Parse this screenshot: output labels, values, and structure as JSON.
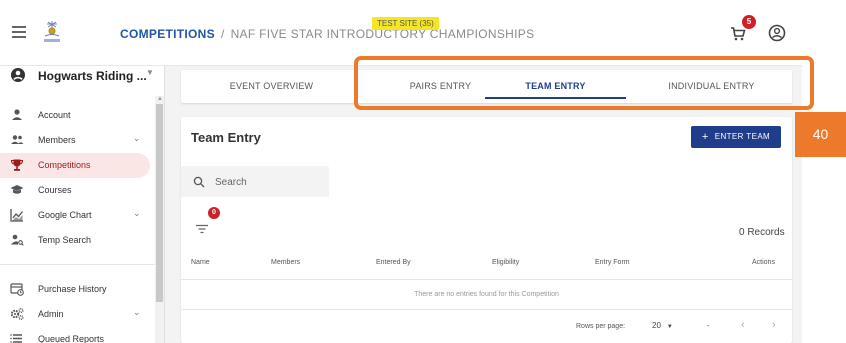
{
  "header": {
    "breadcrumb_link": "COMPETITIONS",
    "breadcrumb_sep": "/",
    "breadcrumb_current": "NAF FIVE STAR INTRODUCTORY CHAMPIONSHIPS",
    "test_badge": "TEST SITE (35)",
    "cart_count": "5"
  },
  "sidebar": {
    "org_name": "Hogwarts Riding ...",
    "items": [
      {
        "label": "Account",
        "icon": "person-icon"
      },
      {
        "label": "Members",
        "icon": "people-icon",
        "expandable": true
      },
      {
        "label": "Competitions",
        "icon": "trophy-icon",
        "active": true
      },
      {
        "label": "Courses",
        "icon": "graduation-cap-icon"
      },
      {
        "label": "Google Chart",
        "icon": "chart-icon",
        "expandable": true
      },
      {
        "label": "Temp Search",
        "icon": "person-search-icon"
      },
      {
        "label": "Purchase History",
        "icon": "purchase-history-icon"
      },
      {
        "label": "Admin",
        "icon": "gears-icon",
        "expandable": true
      },
      {
        "label": "Queued Reports",
        "icon": "list-icon"
      }
    ]
  },
  "tabs": [
    {
      "label": "EVENT OVERVIEW"
    },
    {
      "label": "PAIRS ENTRY"
    },
    {
      "label": "TEAM ENTRY",
      "active": true
    },
    {
      "label": "INDIVIDUAL ENTRY"
    }
  ],
  "team_entry": {
    "title": "Team Entry",
    "enter_button": "ENTER TEAM",
    "search_placeholder": "Search",
    "filter_count": "0",
    "records": "0 Records",
    "columns": [
      "Name",
      "Members",
      "Entered By",
      "Eligibility",
      "Entry Form",
      "Actions"
    ],
    "empty_message": "There are no entries found for this Competition",
    "rows_per_page_label": "Rows per page:",
    "rows_per_page_value": "20",
    "range": "-"
  },
  "annotation": {
    "number": "40"
  },
  "colors": {
    "primary": "#1f3d8a",
    "highlight": "#ec7a2a",
    "active_nav_bg": "#fbe6e6",
    "badge_red": "#d21e26"
  }
}
